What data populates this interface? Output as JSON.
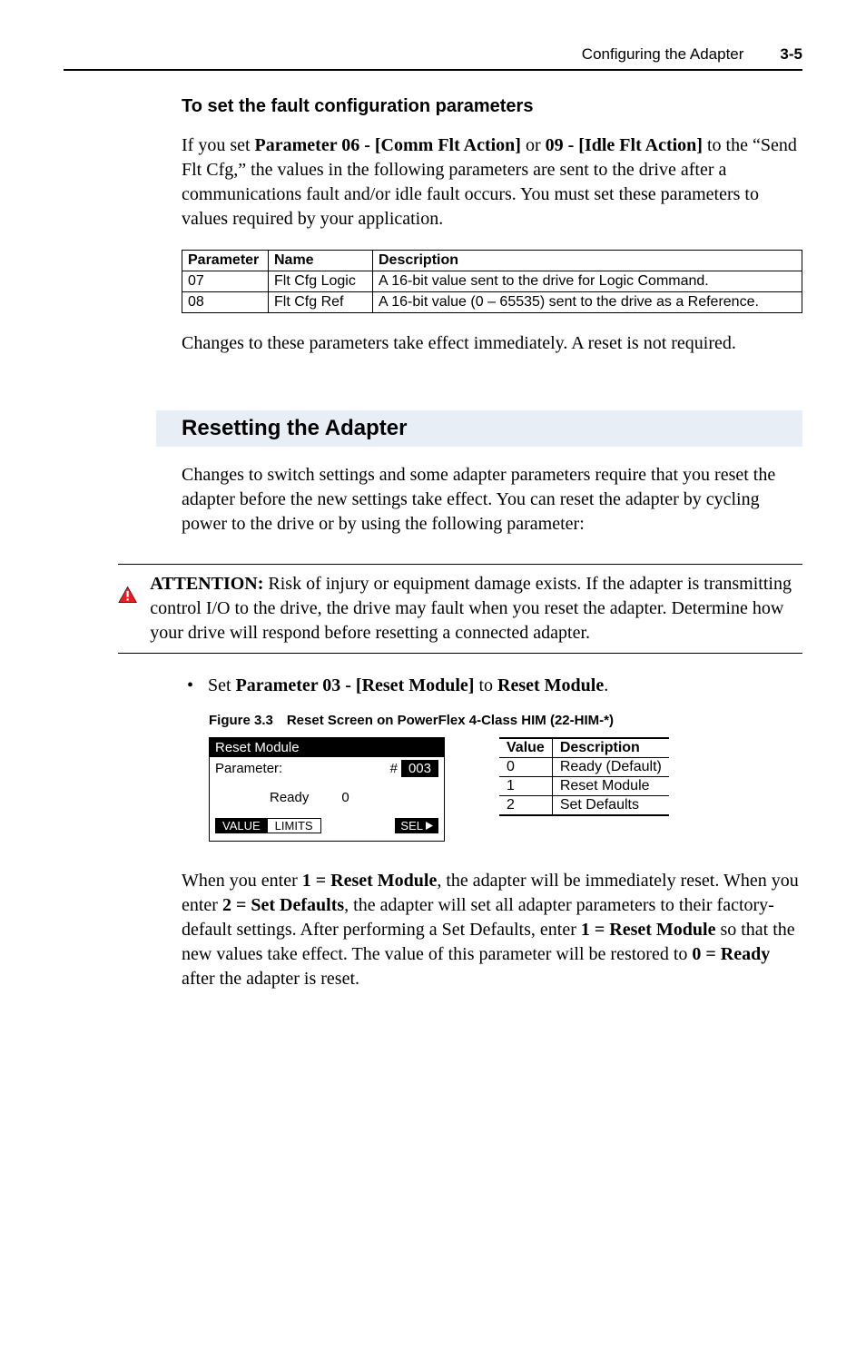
{
  "header": {
    "section": "Configuring the Adapter",
    "page": "3-5"
  },
  "h3_1": "To set the fault configuration parameters",
  "p1_pre": "If you set ",
  "p1_b1": "Parameter 06 - [Comm Flt Action]",
  "p1_mid": " or ",
  "p1_b2": "09 - [Idle Flt Action]",
  "p1_post": " to the “Send Flt Cfg,” the values in the following parameters are sent to the drive after a communications fault and/or idle fault occurs. You must set these parameters to values required by your application.",
  "paramTable": {
    "headers": [
      "Parameter",
      "Name",
      "Description"
    ],
    "rows": [
      [
        "07",
        "Flt Cfg Logic",
        "A 16-bit value sent to the drive for Logic Command."
      ],
      [
        "08",
        "Flt Cfg Ref",
        "A 16-bit value (0 – 65535) sent to the drive as a Reference."
      ]
    ]
  },
  "p2": "Changes to these parameters take effect immediately. A reset is not required.",
  "sectionTitle": "Resetting the Adapter",
  "p3": "Changes to switch settings and some adapter parameters require that you reset the adapter before the new settings take effect. You can reset the adapter by cycling power to the drive or by using the following parameter:",
  "attention_b": "ATTENTION:",
  "attention_t": "  Risk of injury or equipment damage exists. If the adapter is transmitting control I/O to the drive, the drive may fault when you reset the adapter. Determine how your drive will respond before resetting a connected adapter.",
  "bullet_pre": "Set ",
  "bullet_b1": "Parameter 03 - [Reset Module]",
  "bullet_mid": " to ",
  "bullet_b2": "Reset Module",
  "bullet_post": ".",
  "figCap": "Figure 3.3 Reset Screen on PowerFlex 4-Class HIM (22-HIM-*)",
  "him": {
    "title": "Reset Module",
    "paramLabel": "Parameter:",
    "hash": "#",
    "id": "003",
    "state": "Ready",
    "zero": "0",
    "footValue": "VALUE",
    "footLimits": "LIMITS",
    "sel": "SEL"
  },
  "valTable": {
    "headers": [
      "Value",
      "Description"
    ],
    "rows": [
      [
        "0",
        "Ready (Default)"
      ],
      [
        "1",
        "Reset Module"
      ],
      [
        "2",
        "Set Defaults"
      ]
    ]
  },
  "p4_1": "When you enter ",
  "p4_b1": "1 = Reset Module",
  "p4_2": ", the adapter will be immediately reset. When you enter ",
  "p4_b2": "2 = Set Defaults",
  "p4_3": ", the adapter will set all adapter parameters to their factory-default settings. After performing a Set Defaults, enter ",
  "p4_b3": "1 = Reset Module",
  "p4_4": " so that the new values take effect. The value of this parameter will be restored to ",
  "p4_b4": "0 = Ready",
  "p4_5": " after the adapter is reset."
}
